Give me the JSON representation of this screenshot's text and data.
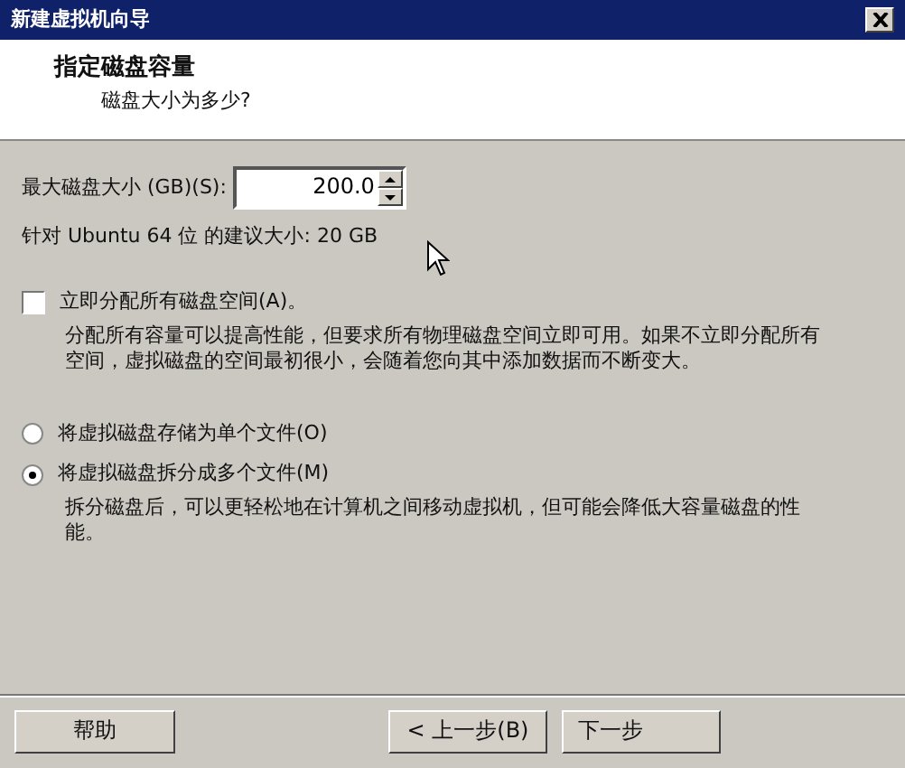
{
  "window": {
    "title": "新建虚拟机向导"
  },
  "header": {
    "title": "指定磁盘容量",
    "subtitle": "磁盘大小为多少?"
  },
  "disk_size": {
    "label": "最大磁盘大小 (GB)(S):",
    "value": "200.0"
  },
  "recommendation": "针对 Ubuntu 64 位 的建议大小: 20 GB",
  "allocate": {
    "label": "立即分配所有磁盘空间(A)。",
    "checked": false,
    "description": "分配所有容量可以提高性能，但要求所有物理磁盘空间立即可用。如果不立即分配所有空间，虚拟磁盘的空间最初很小，会随着您向其中添加数据而不断变大。"
  },
  "storage_options": [
    {
      "label": "将虚拟磁盘存储为单个文件(O)",
      "selected": false
    },
    {
      "label": "将虚拟磁盘拆分成多个文件(M)",
      "selected": true
    }
  ],
  "split_description": "拆分磁盘后，可以更轻松地在计算机之间移动虚拟机，但可能会降低大容量磁盘的性能。",
  "buttons": [
    {
      "label": "帮助",
      "kind": "help"
    },
    {
      "label": "< 上一步(B)",
      "kind": "back"
    },
    {
      "label": "下一步",
      "kind": "next"
    }
  ]
}
